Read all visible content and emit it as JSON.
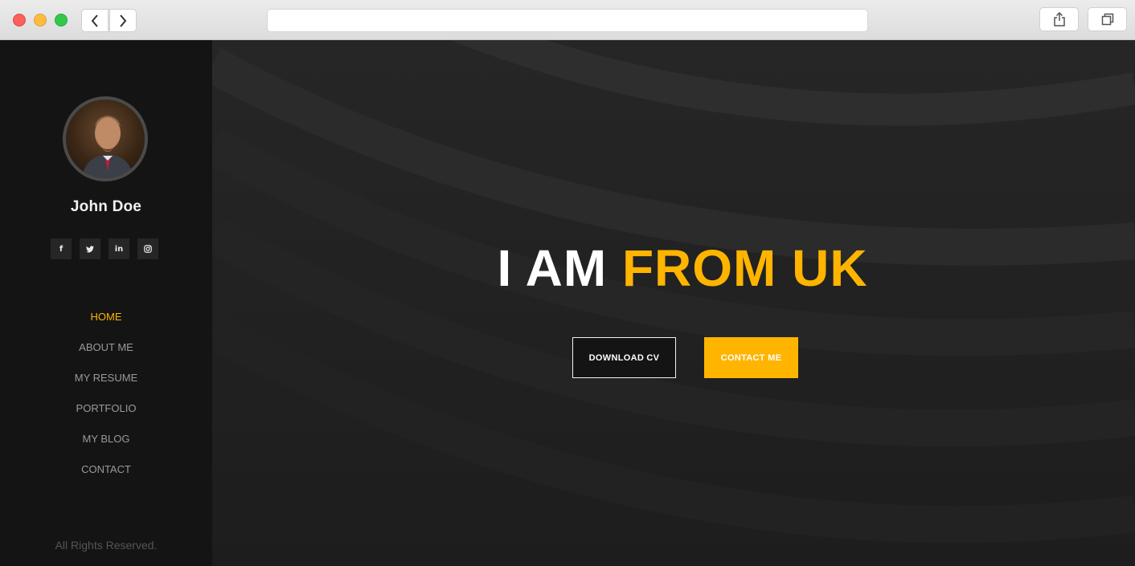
{
  "browser": {
    "url": "",
    "icons": [
      "close-window-icon",
      "minimize-window-icon",
      "maximize-window-icon",
      "chevron-left-icon",
      "chevron-right-icon",
      "share-icon",
      "tabs-icon"
    ]
  },
  "profile": {
    "name": "John Doe",
    "socials": [
      {
        "icon": "facebook-icon",
        "glyph": "f"
      },
      {
        "icon": "twitter-icon",
        "glyph": "t"
      },
      {
        "icon": "linkedin-icon",
        "glyph": "in"
      },
      {
        "icon": "instagram-icon",
        "glyph": "◎"
      }
    ]
  },
  "nav": {
    "items": [
      {
        "label": "HOME",
        "active": true
      },
      {
        "label": "ABOUT ME",
        "active": false
      },
      {
        "label": "MY RESUME",
        "active": false
      },
      {
        "label": "PORTFOLIO",
        "active": false
      },
      {
        "label": "MY BLOG",
        "active": false
      },
      {
        "label": "CONTACT",
        "active": false
      }
    ]
  },
  "footer": {
    "text": "All Rights Reserved."
  },
  "hero": {
    "headline_white": "I AM",
    "headline_accent": "FROM UK",
    "download_label": "DOWNLOAD CV",
    "contact_label": "CONTACT ME"
  },
  "colors": {
    "accent": "#ffb400",
    "sidebar_bg": "#141414",
    "main_bg": "#222222",
    "nav_text": "#9a9a9a"
  }
}
